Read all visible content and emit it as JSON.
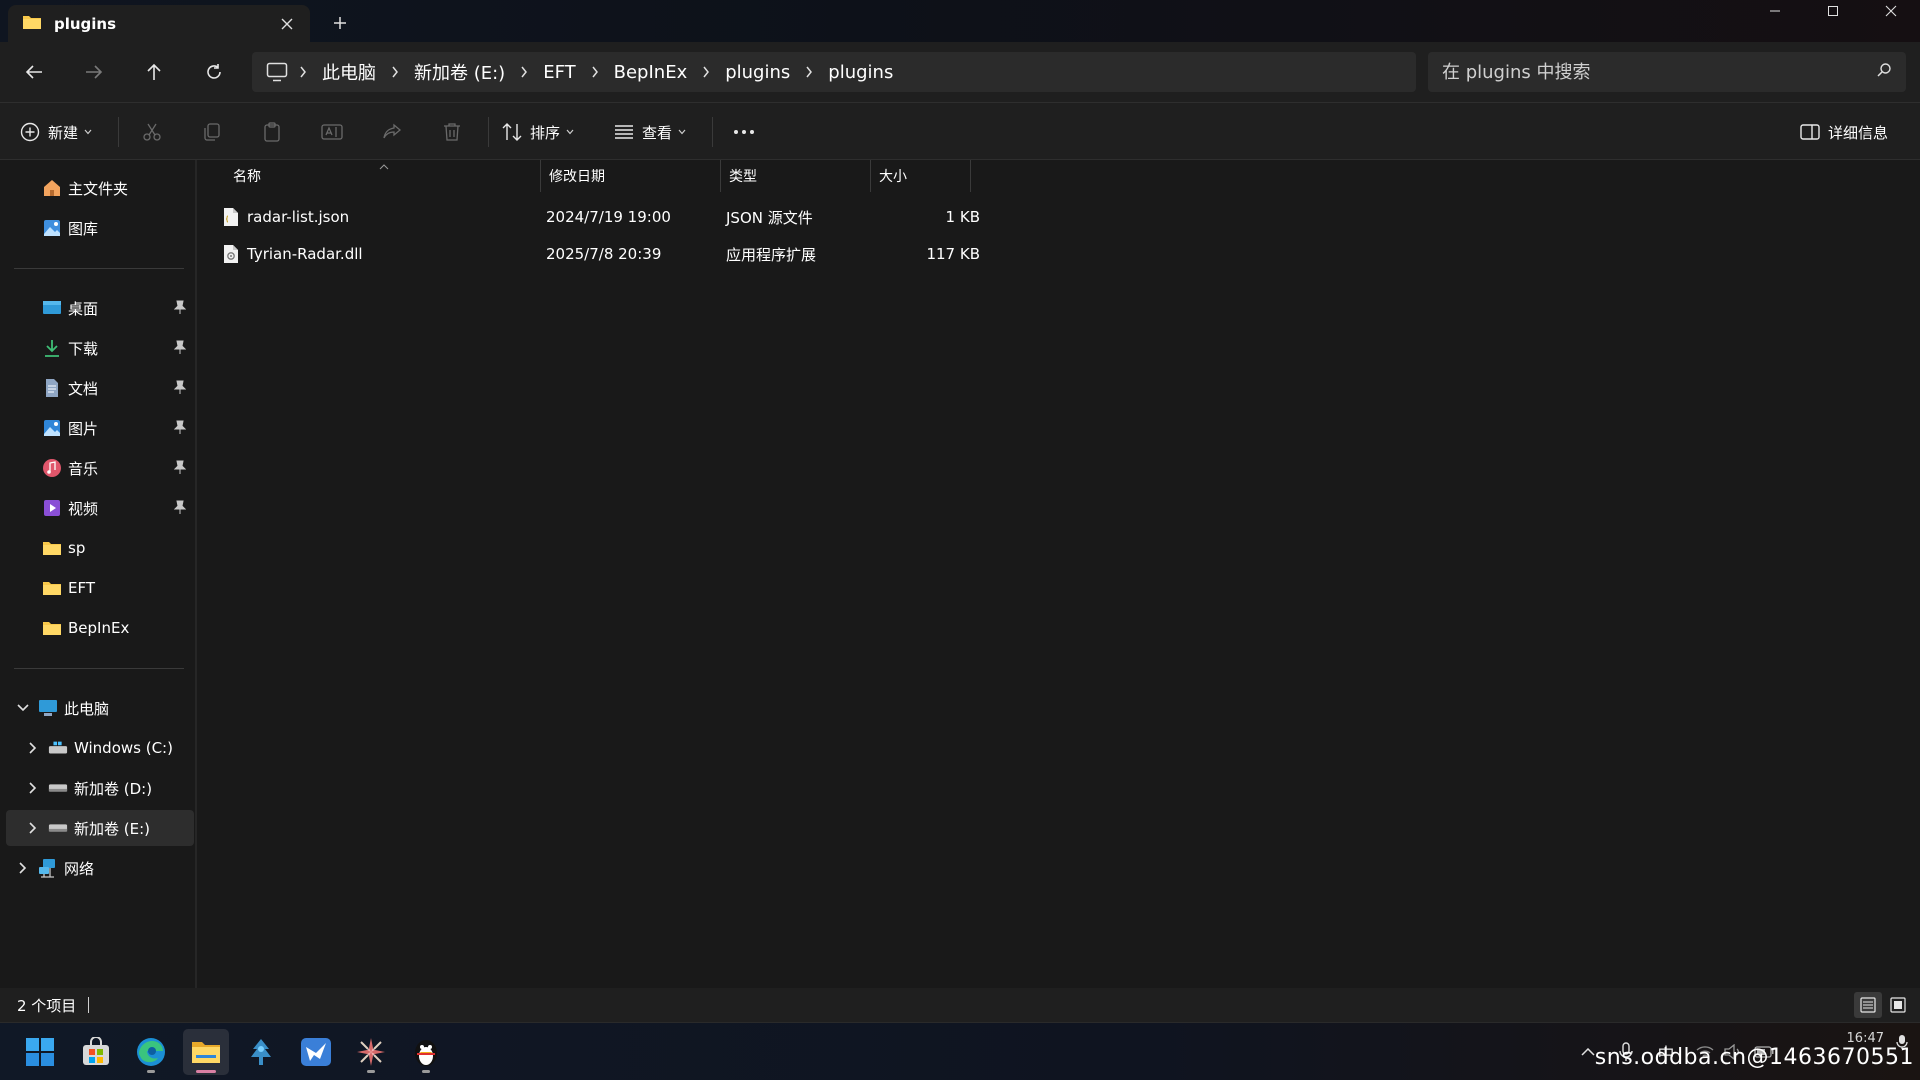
{
  "window": {
    "tab_title": "plugins",
    "colors": {
      "folder": "#f8c84a",
      "accent": "#4cc2ff",
      "drive": "#c8c8c8"
    }
  },
  "address": {
    "root_icon": "computer-icon",
    "breadcrumbs": [
      "此电脑",
      "新加卷 (E:)",
      "EFT",
      "BepInEx",
      "plugins",
      "plugins"
    ]
  },
  "search": {
    "placeholder": "在 plugins 中搜索"
  },
  "commandbar": {
    "new_label": "新建",
    "sort_label": "排序",
    "view_label": "查看",
    "details_label": "详细信息"
  },
  "sidebar": {
    "top": [
      {
        "label": "主文件夹",
        "icon": "home-icon"
      },
      {
        "label": "图库",
        "icon": "gallery-icon"
      }
    ],
    "quick": [
      {
        "label": "桌面",
        "icon": "desktop-icon",
        "pinned": true
      },
      {
        "label": "下载",
        "icon": "download-icon",
        "pinned": true
      },
      {
        "label": "文档",
        "icon": "document-icon",
        "pinned": true
      },
      {
        "label": "图片",
        "icon": "pictures-icon",
        "pinned": true
      },
      {
        "label": "音乐",
        "icon": "music-icon",
        "pinned": true
      },
      {
        "label": "视频",
        "icon": "video-icon",
        "pinned": true
      },
      {
        "label": "sp",
        "icon": "folder-icon",
        "pinned": false
      },
      {
        "label": "EFT",
        "icon": "folder-icon",
        "pinned": false
      },
      {
        "label": "BepInEx",
        "icon": "folder-icon",
        "pinned": false
      }
    ],
    "tree": {
      "this_pc": "此电脑",
      "drives": [
        "Windows (C:)",
        "新加卷 (D:)",
        "新加卷 (E:)"
      ],
      "network": "网络"
    }
  },
  "files": {
    "columns": [
      "名称",
      "修改日期",
      "类型",
      "大小"
    ],
    "rows": [
      {
        "name": "radar-list.json",
        "date": "2024/7/19 19:00",
        "type": "JSON 源文件",
        "size": "1 KB"
      },
      {
        "name": "Tyrian-Radar.dll",
        "date": "2025/7/8 20:39",
        "type": "应用程序扩展",
        "size": "117 KB"
      }
    ]
  },
  "status": {
    "count": "2 个项目"
  },
  "taskbar": {
    "clock_time": "16:47",
    "ime": "中",
    "watermark": "sns.oddba.cn@1463670551"
  }
}
